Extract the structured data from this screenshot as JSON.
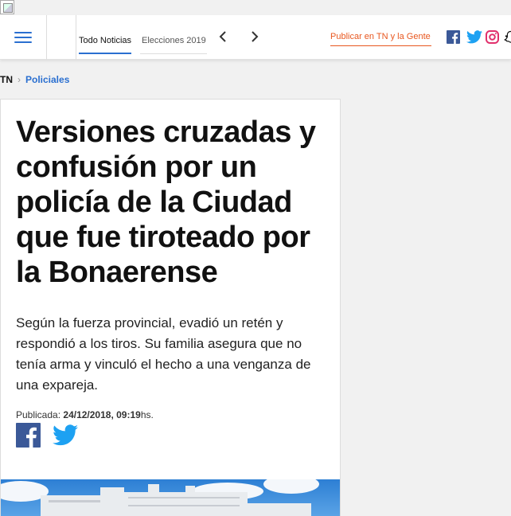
{
  "nav": {
    "tabs": [
      {
        "label": "Todo Noticias",
        "active": true
      },
      {
        "label": "Elecciones 2019",
        "active": false
      }
    ],
    "publish_link": "Publicar en TN y la Gente",
    "social": [
      "facebook-icon",
      "twitter-icon",
      "instagram-icon",
      "snapchat-icon"
    ]
  },
  "breadcrumb": {
    "root": "TN",
    "category": "Policiales"
  },
  "article": {
    "headline": "Versiones cruzadas y confusión por un policía de la Ciudad que fue tiroteado por la Bonaerense",
    "lead": "Según la fuerza provincial, evadió un retén y respondió a los tiros. Su familia asegura que no tenía arma y vinculó el hecho a una venganza de una expareja.",
    "published_label": "Publicada:",
    "published_date": "24/12/2018, 09:19",
    "published_suffix": "hs."
  },
  "colors": {
    "accent": "#2a6fd0",
    "publish": "#e8571f",
    "facebook": "#3b5998",
    "twitter": "#1da1f2",
    "instagram": "#e1306c"
  }
}
